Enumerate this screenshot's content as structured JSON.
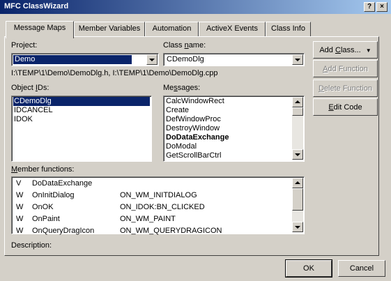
{
  "window": {
    "title": "MFC ClassWizard",
    "help_glyph": "?",
    "close_glyph": "×"
  },
  "tabs": [
    {
      "label": "Message Maps",
      "active": true
    },
    {
      "label": "Member Variables",
      "active": false
    },
    {
      "label": "Automation",
      "active": false
    },
    {
      "label": "ActiveX Events",
      "active": false
    },
    {
      "label": "Class Info",
      "active": false
    }
  ],
  "project": {
    "label_pre": "Pro",
    "label_key": "j",
    "label_post": "ect:",
    "value": "Demo"
  },
  "class_name": {
    "label_pre": "Class ",
    "label_key": "n",
    "label_post": "ame:",
    "value": "CDemoDlg"
  },
  "file_path": "I:\\TEMP\\1\\Demo\\DemoDlg.h, I:\\TEMP\\1\\Demo\\DemoDlg.cpp",
  "object_ids": {
    "label_pre": "Object ",
    "label_key": "I",
    "label_post": "Ds:",
    "items": [
      "CDemoDlg",
      "IDCANCEL",
      "IDOK"
    ],
    "selected_index": 0
  },
  "messages": {
    "label_pre": "Me",
    "label_key": "s",
    "label_post": "sages:",
    "items": [
      "CalcWindowRect",
      "Create",
      "DefWindowProc",
      "DestroyWindow",
      "DoDataExchange",
      "DoModal",
      "GetScrollBarCtrl"
    ],
    "bold_index": 4
  },
  "member_functions": {
    "label_pre": "",
    "label_key": "M",
    "label_post": "ember functions:",
    "rows": [
      {
        "kind": "V",
        "name": "DoDataExchange",
        "impl": ""
      },
      {
        "kind": "W",
        "name": "OnInitDialog",
        "impl": "ON_WM_INITDIALOG"
      },
      {
        "kind": "W",
        "name": "OnOK",
        "impl": "ON_IDOK:BN_CLICKED"
      },
      {
        "kind": "W",
        "name": "OnPaint",
        "impl": "ON_WM_PAINT"
      },
      {
        "kind": "W",
        "name": "OnQueryDragIcon",
        "impl": "ON_WM_QUERYDRAGICON"
      }
    ]
  },
  "description_label": "Description:",
  "buttons": {
    "add_class": {
      "pre": "Add ",
      "key": "C",
      "post": "lass...",
      "arrow": "▼"
    },
    "add_function": {
      "pre": "",
      "key": "A",
      "post": "dd Function"
    },
    "delete_function": {
      "pre": "",
      "key": "D",
      "post": "elete Function"
    },
    "edit_code": {
      "pre": "",
      "key": "E",
      "post": "dit Code"
    },
    "ok": "OK",
    "cancel": "Cancel"
  }
}
